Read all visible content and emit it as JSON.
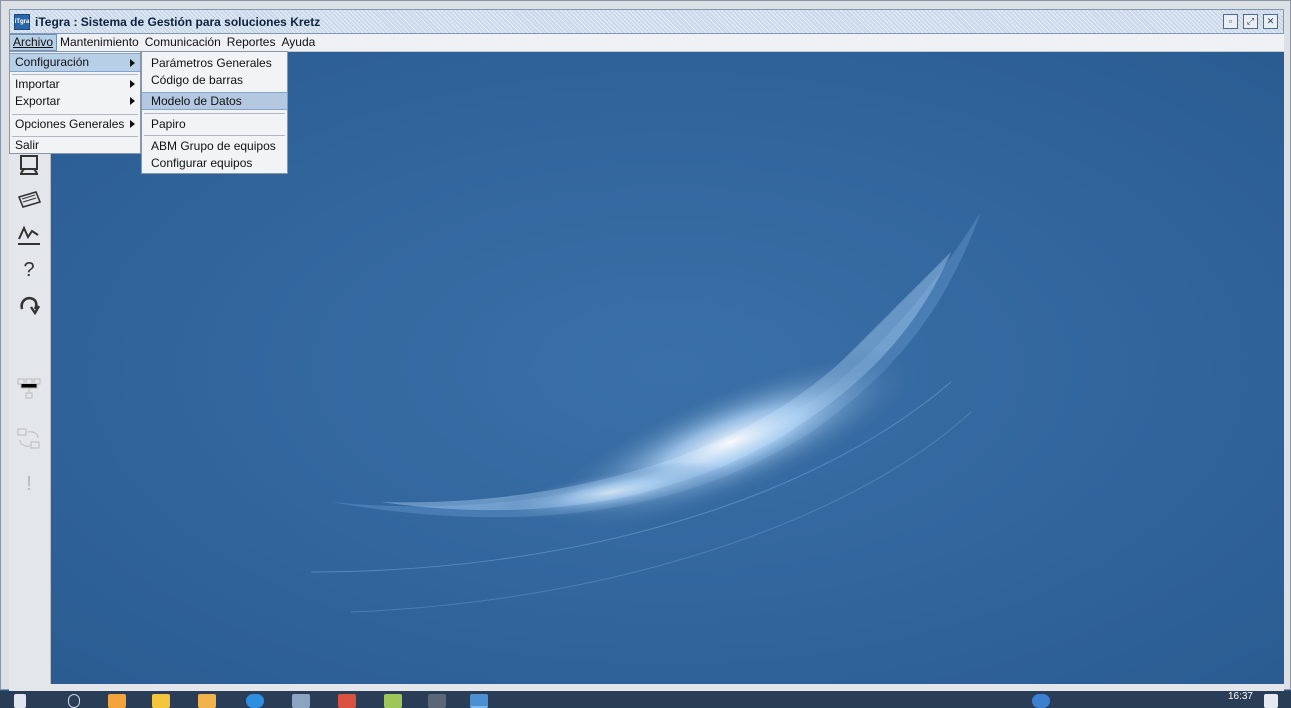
{
  "window": {
    "title": "iTegra : Sistema de Gestión para soluciones Kretz",
    "icon_text": "iTgra",
    "controls": [
      "minimize-icon",
      "maximize-icon",
      "close-icon"
    ]
  },
  "menubar": [
    {
      "label": "Archivo",
      "active": true
    },
    {
      "label": "Mantenimiento"
    },
    {
      "label": "Comunicación"
    },
    {
      "label": "Reportes"
    },
    {
      "label": "Ayuda"
    }
  ],
  "archivo_menu": [
    {
      "label": "Configuración",
      "submenu": true,
      "active": true
    },
    {
      "label": "Importar",
      "submenu": true
    },
    {
      "label": "Exportar",
      "submenu": true
    },
    {
      "label": "Opciones Generales",
      "submenu": true
    },
    {
      "label": "Salir"
    }
  ],
  "config_submenu": [
    {
      "label": "Parámetros Generales"
    },
    {
      "label": "Código de barras"
    },
    {
      "label": "Modelo de Datos",
      "active": true
    },
    {
      "label": "Papiro"
    },
    {
      "label": "ABM Grupo de equipos"
    },
    {
      "label": "Configurar equipos"
    }
  ],
  "toolbar": {
    "glyphs": {
      "help": "?",
      "warning": "!"
    }
  },
  "taskbar": {
    "time": "16:37"
  },
  "colors": {
    "desktop": "#2c5f95",
    "selection": "#b8cfe8"
  }
}
